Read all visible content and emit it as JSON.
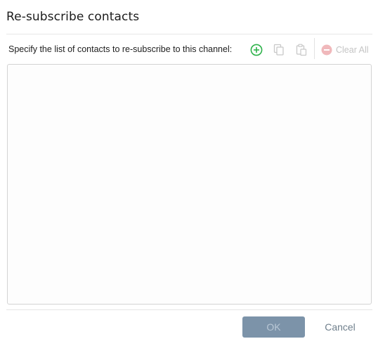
{
  "dialog": {
    "title": "Re-subscribe contacts",
    "instruction": "Specify the list of contacts to re-subscribe to this channel:"
  },
  "toolbar": {
    "add_icon": "add-circle-icon",
    "copy_icon": "copy-icon",
    "paste_icon": "paste-icon",
    "clear_icon": "remove-circle-icon",
    "clear_label": "Clear All"
  },
  "contacts": [],
  "footer": {
    "ok_label": "OK",
    "cancel_label": "Cancel"
  },
  "colors": {
    "add": "#2db24a",
    "disabled": "#c4c4c4",
    "ok_bg": "#7c93a9",
    "cancel_text": "#6f7f8c"
  }
}
